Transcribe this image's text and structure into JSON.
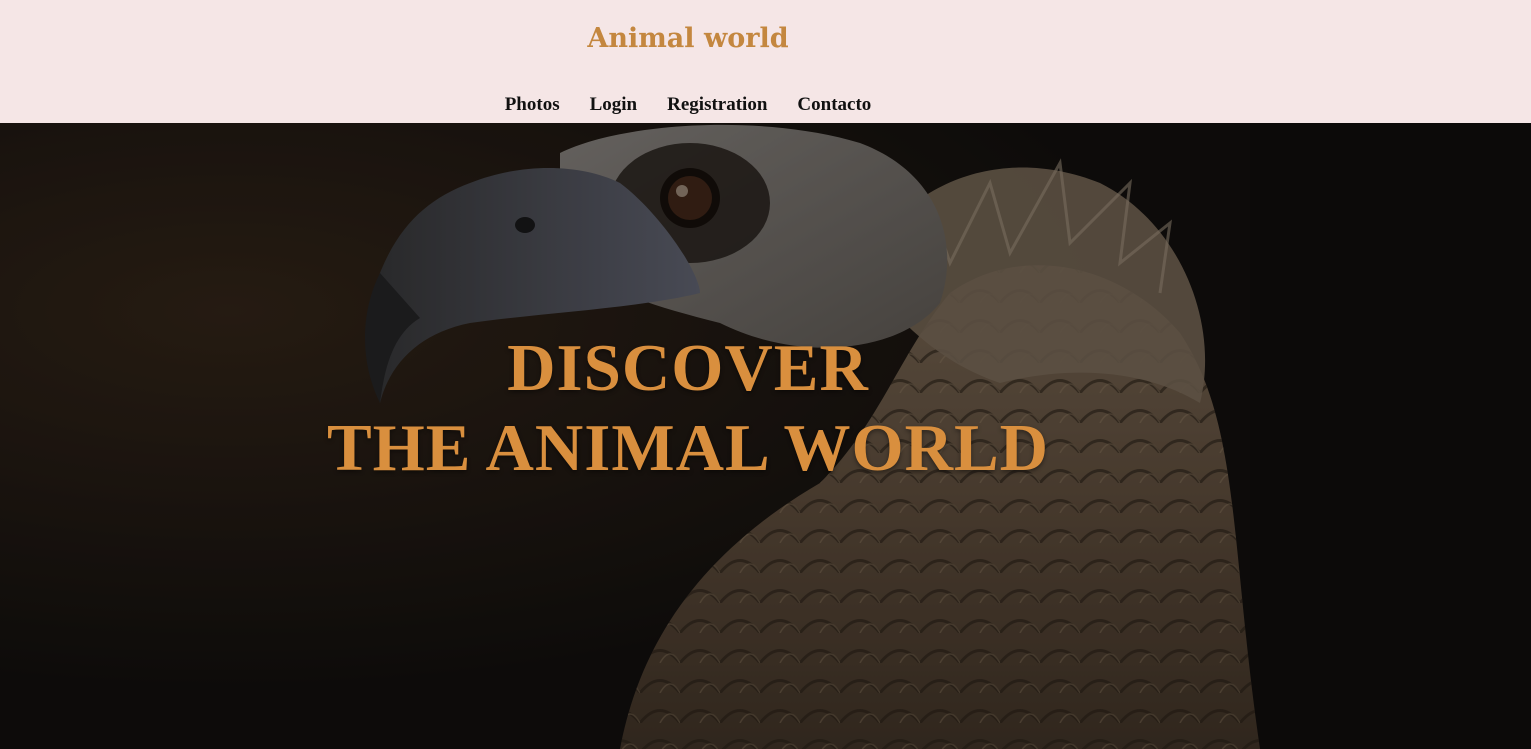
{
  "header": {
    "title": "Animal world",
    "nav": [
      {
        "label": "Photos"
      },
      {
        "label": "Login"
      },
      {
        "label": "Registration"
      },
      {
        "label": "Contacto"
      }
    ]
  },
  "hero": {
    "line1": "DISCOVER",
    "line2": "THE ANIMAL WORLD",
    "image": "vulture-photo"
  },
  "colors": {
    "header_bg": "#f5e6e6",
    "title": "#c4873f",
    "hero_text": "#d98f3e",
    "nav_text": "#111111"
  }
}
